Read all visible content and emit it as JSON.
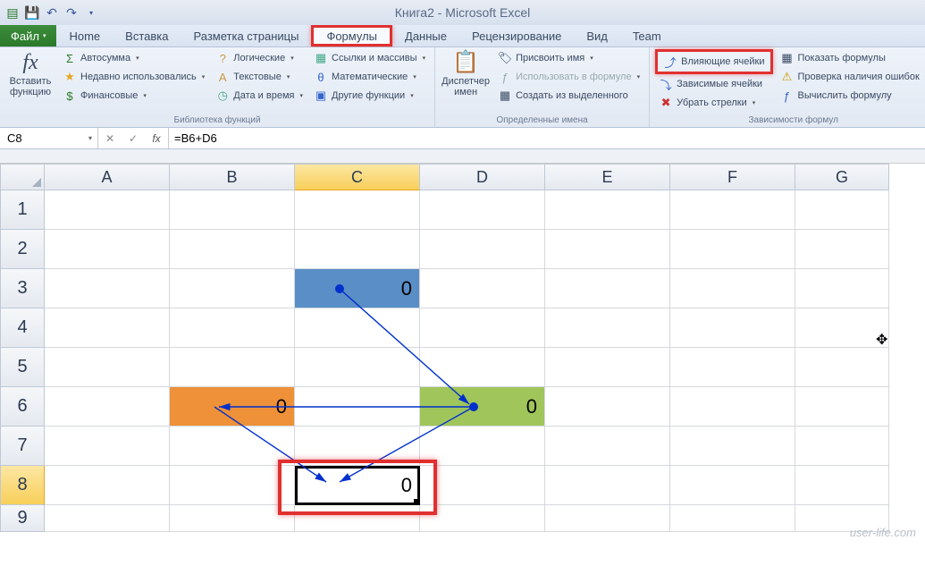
{
  "title": "Книга2 - Microsoft Excel",
  "file_tab": "Файл",
  "tabs": [
    "Home",
    "Вставка",
    "Разметка страницы",
    "Формулы",
    "Данные",
    "Рецензирование",
    "Вид",
    "Team"
  ],
  "ribbon": {
    "insert_fn_big": "Вставить функцию",
    "lib": {
      "autosum": "Автосумма",
      "recent": "Недавно использовались",
      "financial": "Финансовые",
      "logical": "Логические",
      "text": "Текстовые",
      "datetime": "Дата и время",
      "lookup": "Ссылки и массивы",
      "math": "Математические",
      "more": "Другие функции",
      "label": "Библиотека функций"
    },
    "names": {
      "manager": "Диспетчер имен",
      "define": "Присвоить имя",
      "use": "Использовать в формуле",
      "create": "Создать из выделенного",
      "label": "Определенные имена"
    },
    "audit": {
      "precedents": "Влияющие ячейки",
      "dependents": "Зависимые ячейки",
      "remove": "Убрать стрелки",
      "show": "Показать формулы",
      "check": "Проверка наличия ошибок",
      "eval": "Вычислить формулу",
      "label": "Зависимости формул"
    }
  },
  "namebox": "C8",
  "formula": "=B6+D6",
  "cols": [
    "A",
    "B",
    "C",
    "D",
    "E",
    "F",
    "G"
  ],
  "rownums": [
    "1",
    "2",
    "3",
    "4",
    "5",
    "6",
    "7",
    "8",
    "9"
  ],
  "cells": {
    "C3": "0",
    "B6": "0",
    "D6": "0",
    "C8": "0"
  },
  "watermark": "user-life.com"
}
